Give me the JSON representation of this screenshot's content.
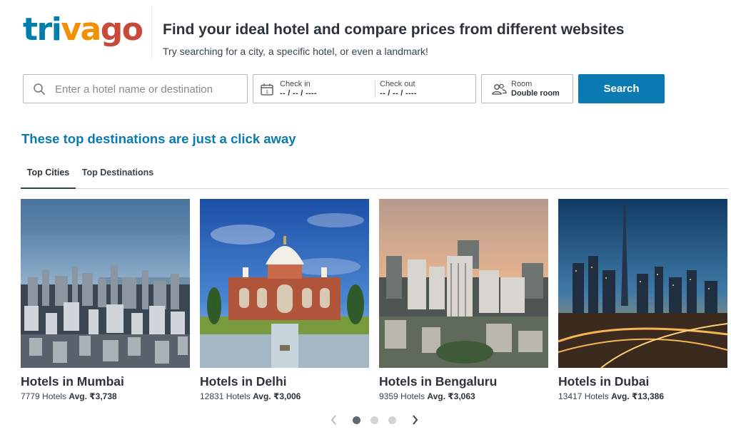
{
  "header": {
    "logo": {
      "part1": "tri",
      "part2": "va",
      "part3": "go"
    },
    "headline": "Find your ideal hotel and compare prices from different websites",
    "subline": "Try searching for a city, a specific hotel, or even a landmark!"
  },
  "search": {
    "destination_placeholder": "Enter a hotel name or destination",
    "destination_value": "",
    "checkin_label": "Check in",
    "checkin_value": "-- / -- / ----",
    "checkout_label": "Check out",
    "checkout_value": "-- / -- / ----",
    "room_label": "Room",
    "room_value": "Double room",
    "button_label": "Search",
    "search_icon": "search-icon",
    "calendar_icon": "calendar-icon",
    "calendar_icon_day": "1",
    "guests_icon": "guests-icon"
  },
  "destinations": {
    "title": "These top destinations are just a click away",
    "tabs": [
      {
        "label": "Top Cities",
        "active": true
      },
      {
        "label": "Top Destinations",
        "active": false
      }
    ],
    "cards": [
      {
        "name": "Hotels in Mumbai",
        "count": "7779 Hotels",
        "avg_label": "Avg.",
        "avg_price": "₹3,738",
        "image": "mumbai-skyline-photo"
      },
      {
        "name": "Hotels in Delhi",
        "count": "12831 Hotels",
        "avg_label": "Avg.",
        "avg_price": "₹3,006",
        "image": "humayuns-tomb-photo"
      },
      {
        "name": "Hotels in Bengaluru",
        "count": "9359 Hotels",
        "avg_label": "Avg.",
        "avg_price": "₹3,063",
        "image": "bengaluru-skyline-photo"
      },
      {
        "name": "Hotels in Dubai",
        "count": "13417 Hotels",
        "avg_label": "Avg.",
        "avg_price": "₹13,386",
        "image": "dubai-skyline-photo"
      }
    ],
    "pager": {
      "pages": 3,
      "current_page": 1,
      "prev_icon": "chevron-left-icon",
      "next_icon": "chevron-right-icon"
    }
  },
  "colors": {
    "brand_blue": "#007fad",
    "brand_orange": "#f48f00",
    "brand_red": "#c94a38",
    "accent": "#0a7bb0",
    "text_dark": "#2c3439"
  }
}
